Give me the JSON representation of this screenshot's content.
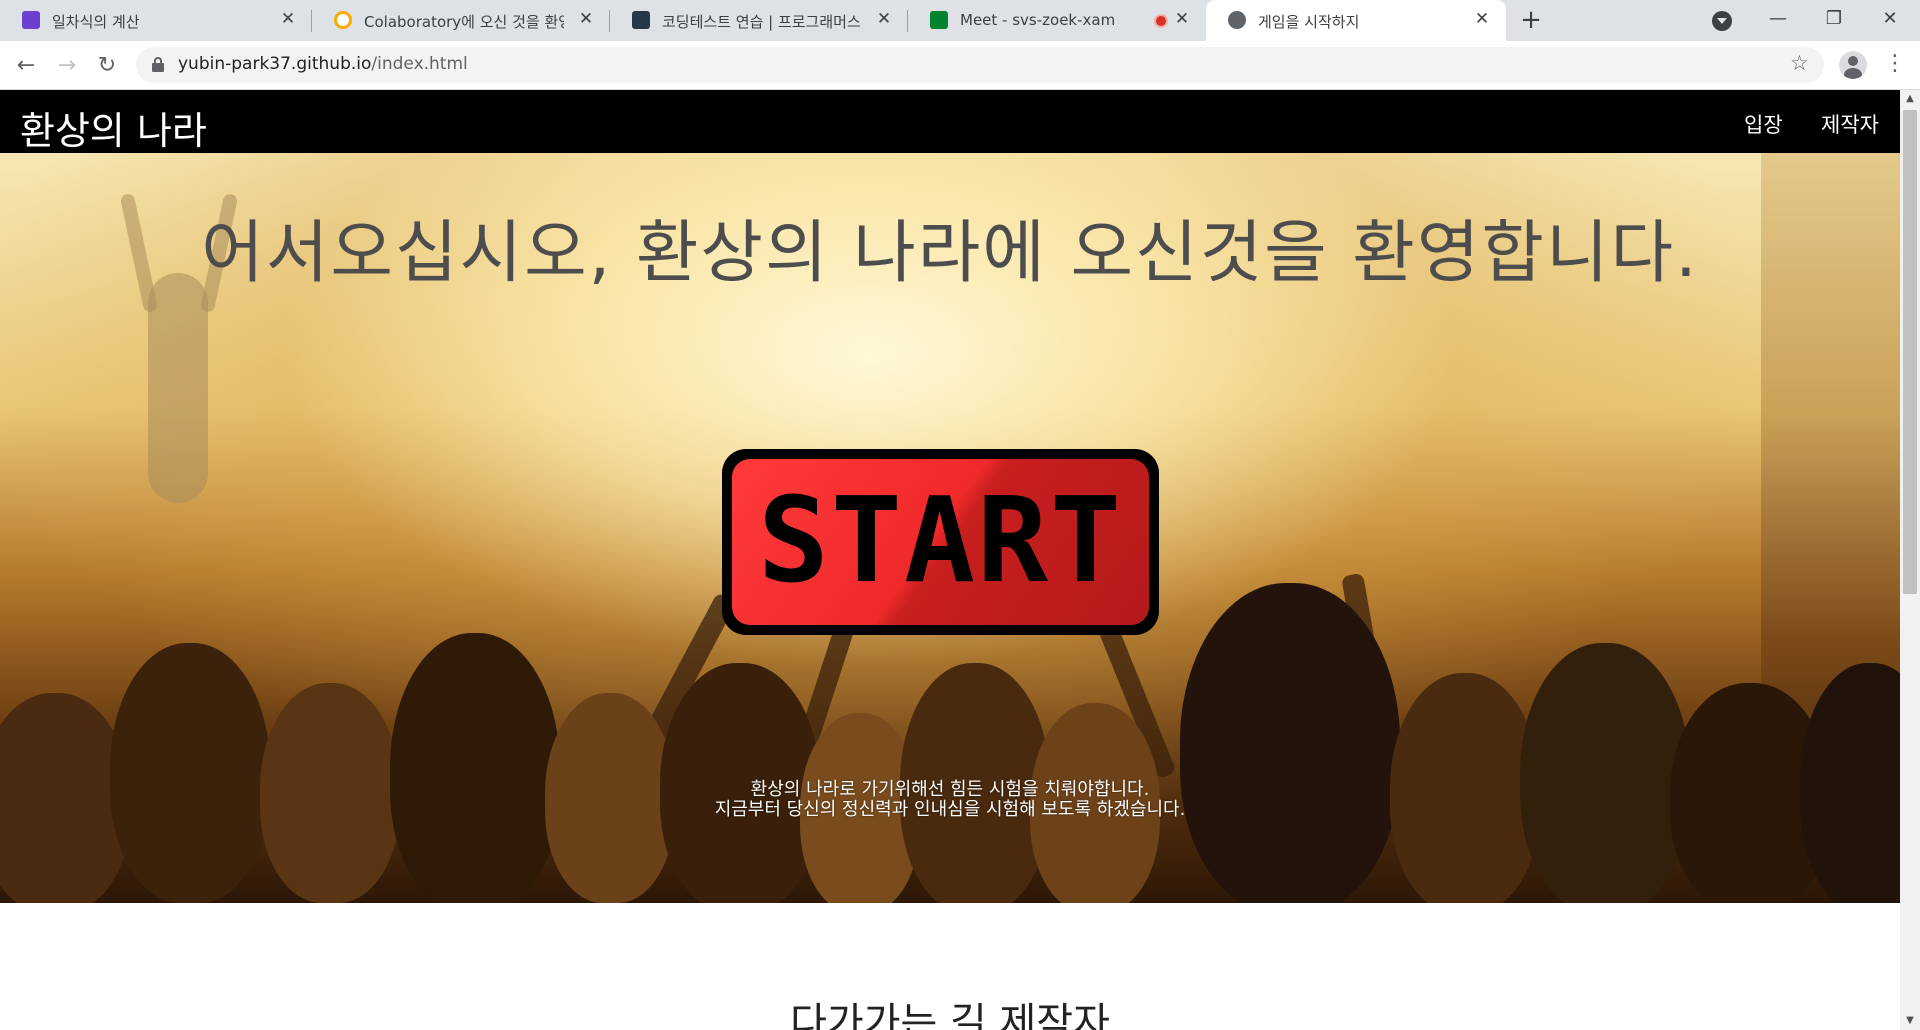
{
  "browser": {
    "tabs": [
      {
        "title": "일차식의 계산",
        "favicon": "list-icon",
        "favicon_color": "#6c3fd0",
        "active": false
      },
      {
        "title": "Colaboratory에 오신 것을 환영합니다",
        "favicon": "colab-icon",
        "favicon_color": "#f9ab00",
        "active": false
      },
      {
        "title": "코딩테스트 연습 | 프로그래머스",
        "favicon": "programmers-icon",
        "favicon_color": "#263747",
        "active": false
      },
      {
        "title": "Meet - svs-zoek-xam",
        "favicon": "meet-icon",
        "favicon_color": "#00832d",
        "active": false,
        "recording": true
      },
      {
        "title": "게임을 시작하지",
        "favicon": "globe-icon",
        "favicon_color": "#5f6368",
        "active": true
      }
    ],
    "address": {
      "host": "yubin-park37.github.io",
      "path": "/index.html"
    },
    "close_glyph": "✕",
    "newtab_glyph": "+",
    "back_glyph": "←",
    "forward_glyph": "→",
    "reload_glyph": "↻",
    "star_glyph": "☆",
    "menu_glyph": "⋮",
    "minimize_glyph": "—",
    "restore_glyph": "❐",
    "window_close_glyph": "✕"
  },
  "site": {
    "brand": "환상의 나라",
    "nav": [
      "입장",
      "제작자"
    ],
    "welcome": "어서오십시오, 환상의 나라에 오신것을 환영합니다.",
    "start_label": "START",
    "notice": [
      "환상의 나라로 가기위해선 힘든 시험을 치뤄야합니다.",
      "지금부터 당신의 정신력과 인내심을 시험해 보도록 하겠습니다."
    ],
    "below_heading": "다가가는 길 제작자",
    "colors": {
      "nav_bg": "#000000",
      "start_red": "#e82828",
      "welcome_text": "#4d4d4d"
    }
  }
}
